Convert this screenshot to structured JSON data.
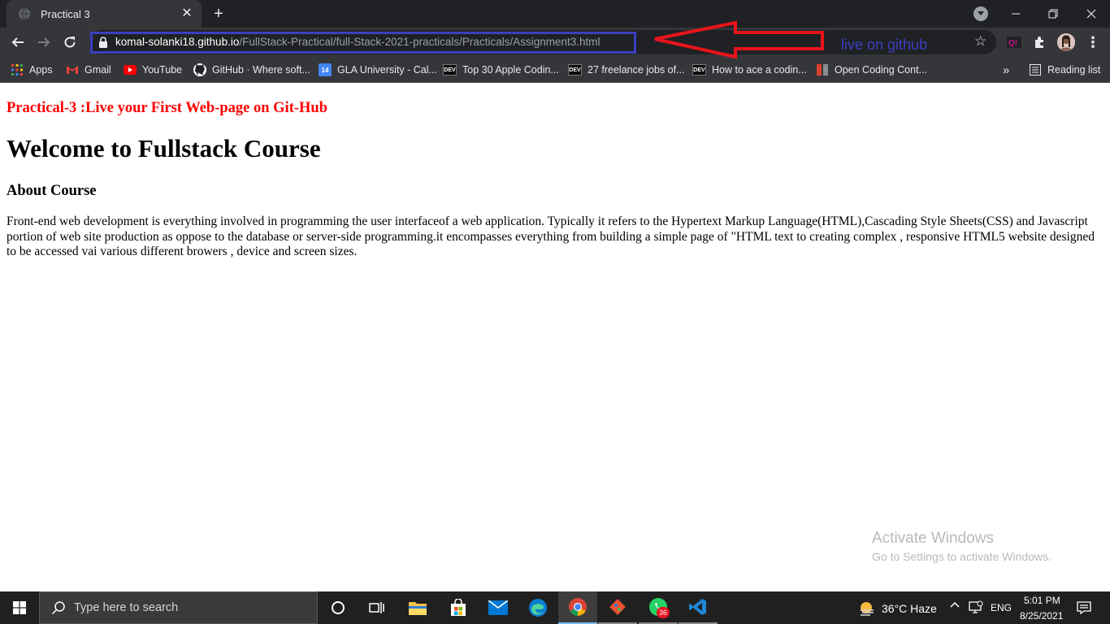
{
  "browser": {
    "tab": {
      "title": "Practical 3"
    },
    "address": {
      "host": "komal-solanki18.github.io",
      "path": "/FullStack-Practical/full-Stack-2021-practicals/Practicals/Assignment3.html"
    },
    "annotation": "live on github",
    "reading_list": "Reading list",
    "bookmarks": [
      {
        "label": "Apps",
        "icon": "apps-grid-icon"
      },
      {
        "label": "Gmail",
        "icon": "gmail-icon"
      },
      {
        "label": "YouTube",
        "icon": "youtube-icon"
      },
      {
        "label": "GitHub · Where soft...",
        "icon": "github-icon"
      },
      {
        "label": "GLA University - Cal...",
        "icon": "calendar-icon"
      },
      {
        "label": "Top 30 Apple Codin...",
        "icon": "dev-icon"
      },
      {
        "label": "27 freelance jobs of...",
        "icon": "dev-icon"
      },
      {
        "label": "How to ace a codin...",
        "icon": "dev-icon"
      },
      {
        "label": "Open Coding Cont...",
        "icon": "tg-icon"
      }
    ],
    "dev_icon_label": "DEV",
    "calendar_icon_label": "14",
    "overflow_label": "»"
  },
  "page": {
    "practical_title": "Practical-3 :Live your First Web-page on Git-Hub",
    "course_title": "Welcome to Fullstack Course",
    "about_title": "About Course",
    "about_text": "Front-end web development is everything involved in programming the user interfaceof a web application. Typically it refers to the Hypertext Markup Language(HTML),Cascading Style Sheets(CSS) and Javascript portion of web site production as oppose to the database or server-side programming.it encompasses everything from building a simple page of \"HTML text to creating complex , responsive HTML5 website designed to be accessed vai various different browers , device and screen sizes."
  },
  "watermark": {
    "title": "Activate Windows",
    "subtitle": "Go to Settings to activate Windows."
  },
  "taskbar": {
    "search_placeholder": "Type here to search",
    "weather": "36°C  Haze",
    "language": "ENG",
    "time": "5:01 PM",
    "date": "8/25/2021",
    "whatsapp_badge": "36"
  },
  "colors": {
    "annotation": "#3b3fc0",
    "arrow": "#e8141b",
    "practical_title": "#ff0000"
  }
}
